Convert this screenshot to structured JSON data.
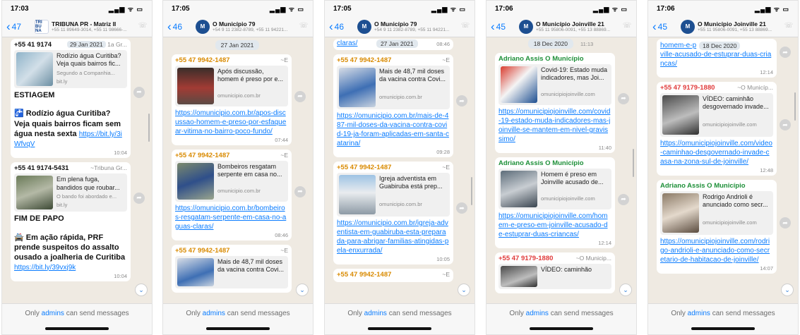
{
  "footer": {
    "prefix": "Only",
    "admins": "admins",
    "suffix": "can send messages"
  },
  "phones": [
    {
      "time": "17:03",
      "back_count": "47",
      "chat_name": "TRIBUNA PR - Matriz II",
      "chat_sub": "+55 11 89649-3014, +55 11 98666-...",
      "avatar_text": "TRI BU NA",
      "top_line": "+55 41 9174",
      "top_date": "29 Jan 2021",
      "top_alias": "1a Gr...",
      "m1_title": "Rodízio água Curitiba? Veja quais bairros fic...",
      "m1_desc": "Segundo a Companhia...",
      "m1_domain": "bit.ly",
      "m1_head": "ESTIAGEM",
      "m1_body": "🚰 Rodízio água Curitiba? Veja quais bairros ficam sem água nesta sexta",
      "m1_link": "https://bit.ly/3iWfvqV",
      "m1_time": "10:04",
      "m2_sender": "+55 41 9174-5431",
      "m2_alias": "~Tribuna Gr...",
      "m2_title": "Em plena fuga, bandidos que roubar...",
      "m2_desc": "O bando foi abordado e...",
      "m2_domain": "bit.ly",
      "m2_head": "FIM DE PAPO",
      "m2_body": "🚔 Em ação rápida, PRF prende suspeitos do assalto ousado a joalheria de Curitiba",
      "m2_link": "https://bit.ly/39vxj9k",
      "m2_time": "10:04"
    },
    {
      "time": "17:05",
      "back_count": "46",
      "chat_name": "O Município 79",
      "chat_sub": "+54 9 11 2382-8789, +55 11 94221...",
      "date_pill": "27 Jan 2021",
      "m1_sender": "+55 47 9942-1487",
      "m1_alias": "~E",
      "m1_title": "Após discussão, homem é preso por e...",
      "m1_domain": "omunicipio.com.br",
      "m1_link": "https://omunicipio.com.br/apos-discussao-homem-e-preso-por-esfaquear-vitima-no-bairro-poco-fundo/",
      "m1_time": "07:44",
      "m2_sender": "+55 47 9942-1487",
      "m2_alias": "~E",
      "m2_title": "Bombeiros resgatam serpente em casa no...",
      "m2_domain": "omunicipio.com.br",
      "m2_link": "https://omunicipio.com.br/bombeiros-resgatam-serpente-em-casa-no-aguas-claras/",
      "m2_time": "08:46",
      "m3_sender": "+55 47 9942-1487",
      "m3_alias": "~E",
      "m3_title": "Mais de 48,7 mil doses da vacina contra Covi..."
    },
    {
      "time": "17:05",
      "back_count": "46",
      "chat_name": "O Município 79",
      "chat_sub": "+54 9 11 2382-8789, +55 11 94221...",
      "top_link": "claras/",
      "top_date": "27 Jan 2021",
      "top_time": "08:46",
      "m1_sender": "+55 47 9942-1487",
      "m1_alias": "~E",
      "m1_title": "Mais de 48,7 mil doses da vacina contra Covi...",
      "m1_domain": "omunicipio.com.br",
      "m1_link": "https://omunicipio.com.br/mais-de-487-mil-doses-da-vacina-contra-covid-19-ja-foram-aplicadas-em-santa-catarina/",
      "m1_time": "09:28",
      "m2_sender": "+55 47 9942-1487",
      "m2_alias": "~E",
      "m2_title": "Igreja adventista em Guabiruba está prep...",
      "m2_domain": "omunicipio.com.br",
      "m2_link": "https://omunicipio.com.br/igreja-adventista-em-guabiruba-esta-preparada-para-abrigar-familias-atingidas-pela-enxurrada/",
      "m2_time": "10:05",
      "m3_sender": "+55 47 9942-1487",
      "m3_alias": "~E"
    },
    {
      "time": "17:06",
      "back_count": "45",
      "chat_name": "O Município Joinville 21",
      "chat_sub": "+55 11 95806-0091, +55 13 88869...",
      "date_pill": "18 Dec 2020",
      "top_time": "11:13",
      "m1_sender": "Adriano Assis O Município",
      "m1_title": "Covid-19: Estado muda indicadores, mas Joi...",
      "m1_domain": "omunicipiojoinville.com",
      "m1_link": "https://omunicipiojoinville.com/covid-19-estado-muda-indicadores-mas-joinville-se-mantem-em-nivel-gravissimo/",
      "m1_time": "11:40",
      "m2_sender": "Adriano Assis O Município",
      "m2_title": "Homem é preso em Joinville acusado de...",
      "m2_domain": "omunicipiojoinville.com",
      "m2_link": "https://omunicipiojoinville.com/homem-e-preso-em-joinville-acusado-de-estuprar-duas-criancas/",
      "m2_time": "12:14",
      "m3_sender": "+55 47 9179-1880",
      "m3_alias": "~O Municip...",
      "m3_title": "VÍDEO: caminhão"
    },
    {
      "time": "17:06",
      "back_count": "45",
      "chat_name": "O Município Joinville 21",
      "chat_sub": "+55 11 95806-0091, +55 13 88869...",
      "top_link_a": "homem-e-p",
      "top_date": "18 Dec 2020",
      "top_link_b": "ville-acusado-de-estuprar-duas-criancas/",
      "top_time": "12:14",
      "m1_sender": "+55 47 9179-1880",
      "m1_alias": "~O Municíp...",
      "m1_title": "VÍDEO: caminhão desgovernado invade...",
      "m1_domain": "omunicipiojoinville.com",
      "m1_link": "https://omunicipiojoinville.com/video-caminhao-desgovernado-invade-casa-na-zona-sul-de-joinville/",
      "m1_time": "12:48",
      "m2_sender": "Adriano Assis O Município",
      "m2_title": "Rodrigo Andrioli é anunciado como secr...",
      "m2_domain": "omunicipiojoinville.com",
      "m2_link": "https://omunicipiojoinville.com/rodrigo-andrioli-e-anunciado-como-secretario-de-habitacao-de-joinville/",
      "m2_time": "14:07"
    }
  ]
}
